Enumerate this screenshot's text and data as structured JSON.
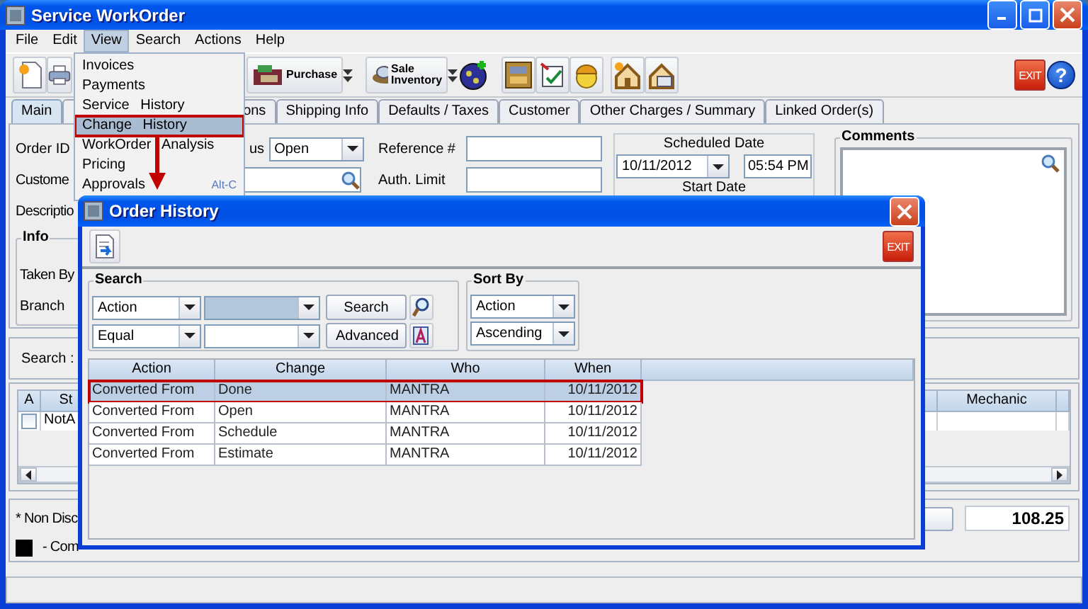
{
  "window": {
    "title": "Service WorkOrder"
  },
  "menu_bar": [
    {
      "label": "File",
      "selected": false
    },
    {
      "label": "Edit",
      "selected": false
    },
    {
      "label": "View",
      "selected": true
    },
    {
      "label": "Search",
      "selected": false
    },
    {
      "label": "Actions",
      "selected": false
    },
    {
      "label": "Help",
      "selected": false
    }
  ],
  "view_menu": [
    {
      "label": "Invoices",
      "selected": false,
      "annotated": false
    },
    {
      "label": "Payments",
      "selected": false,
      "annotated": false
    },
    {
      "label": "Service History",
      "selected": false,
      "annotated": false
    },
    {
      "label": "Change History",
      "selected": true,
      "annotated": true
    },
    {
      "label": "WorkOrder Analysis",
      "selected": false,
      "annotated": false
    },
    {
      "label": "Pricing",
      "selected": false,
      "annotated": false
    },
    {
      "label": "Approvals",
      "shortcut": "Alt-C",
      "selected": false,
      "annotated": false
    }
  ],
  "toolbar": {
    "purchase": "Purchase",
    "sale_inventory": "Sale Inventory",
    "exit": "EXIT",
    "help": "?"
  },
  "tabs": [
    {
      "label": "Main",
      "selected": true
    },
    {
      "label": "ons",
      "selected": false
    },
    {
      "label": "Shipping Info",
      "selected": false
    },
    {
      "label": "Defaults / Taxes",
      "selected": false
    },
    {
      "label": "Customer",
      "selected": false
    },
    {
      "label": "Other Charges / Summary",
      "selected": false
    },
    {
      "label": "Linked Order(s)",
      "selected": false
    }
  ],
  "form": {
    "order_id_label": "Order ID",
    "customer_label": "Custome",
    "description_label": "Descriptio",
    "info_title": "Info",
    "taken_by_label": "Taken By",
    "branch_label": "Branch",
    "status_label": "us",
    "status_value": "Open",
    "reference_label": "Reference #",
    "auth_limit_label": "Auth. Limit",
    "scheduled_date_label": "Scheduled Date",
    "scheduled_date": "10/11/2012",
    "scheduled_time": "05:54 PM",
    "start_date_label": "Start Date",
    "comments_title": "Comments"
  },
  "lines": {
    "search_label": "Search :",
    "columns": [
      "A",
      "St",
      "Mechanic"
    ],
    "rows": [
      {
        "checked": false,
        "status": "NotA"
      }
    ]
  },
  "footer": {
    "note": "* Non Disc",
    "legend": "- Com",
    "total": "108.25"
  },
  "dialog": {
    "title": "Order History",
    "exit": "EXIT",
    "search": {
      "title": "Search",
      "field": "Action",
      "value_focused": true,
      "operator": "Equal",
      "search_button": "Search",
      "advanced_button": "Advanced"
    },
    "sort": {
      "title": "Sort By",
      "field": "Action",
      "order": "Ascending"
    },
    "columns": [
      "Action",
      "Change",
      "Who",
      "When"
    ],
    "rows": [
      {
        "action": "Converted From",
        "change": "Done",
        "who": "MANTRA",
        "when": "10/11/2012",
        "selected": true,
        "annotated": true
      },
      {
        "action": "Converted From",
        "change": "Open",
        "who": "MANTRA",
        "when": "10/11/2012",
        "selected": false,
        "annotated": false
      },
      {
        "action": "Converted From",
        "change": "Schedule",
        "who": "MANTRA",
        "when": "10/11/2012",
        "selected": false,
        "annotated": false
      },
      {
        "action": "Converted From",
        "change": "Estimate",
        "who": "MANTRA",
        "when": "10/11/2012",
        "selected": false,
        "annotated": false
      }
    ]
  }
}
